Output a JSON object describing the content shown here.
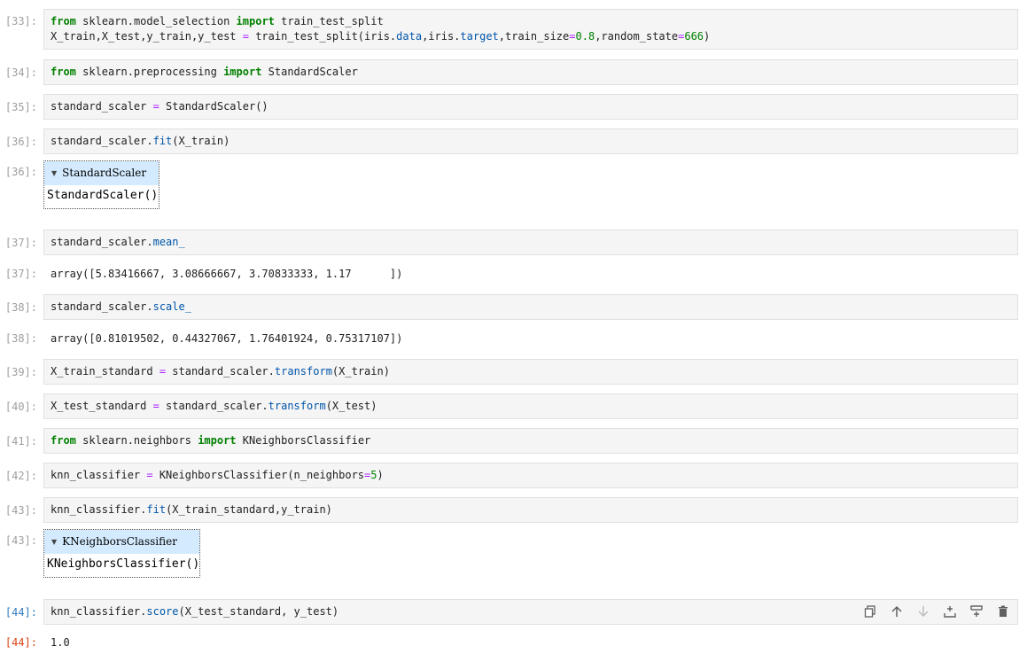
{
  "cells": [
    {
      "in_prompt": "[33]:",
      "line1_tokens": [
        "from",
        "sklearn.model_selection",
        "import",
        "train_test_split"
      ],
      "line2": "X_train,X_test,y_train,y_test = train_test_split(iris.data,iris.target,train_size=0.8,random_state=666)"
    },
    {
      "in_prompt": "[34]:",
      "text": "from sklearn.preprocessing import StandardScaler"
    },
    {
      "in_prompt": "[35]:",
      "text": "standard_scaler = StandardScaler()"
    },
    {
      "in_prompt": "[36]:",
      "text": "standard_scaler.fit(X_train)"
    },
    {
      "out_prompt": "[36]:",
      "widget_title": "StandardScaler",
      "widget_body": "StandardScaler()"
    },
    {
      "in_prompt": "[37]:",
      "text": "standard_scaler.mean_"
    },
    {
      "out_prompt": "[37]:",
      "output": "array([5.83416667, 3.08666667, 3.70833333, 1.17      ])"
    },
    {
      "in_prompt": "[38]:",
      "text": "standard_scaler.scale_"
    },
    {
      "out_prompt": "[38]:",
      "output": "array([0.81019502, 0.44327067, 1.76401924, 0.75317107])"
    },
    {
      "in_prompt": "[39]:",
      "text": "X_train_standard = standard_scaler.transform(X_train)"
    },
    {
      "in_prompt": "[40]:",
      "text": "X_test_standard = standard_scaler.transform(X_test)"
    },
    {
      "in_prompt": "[41]:",
      "text": "from sklearn.neighbors import KNeighborsClassifier"
    },
    {
      "in_prompt": "[42]:",
      "text": "knn_classifier = KNeighborsClassifier(n_neighbors=5)"
    },
    {
      "in_prompt": "[43]:",
      "text": "knn_classifier.fit(X_train_standard,y_train)"
    },
    {
      "out_prompt": "[43]:",
      "widget_title": "KNeighborsClassifier",
      "widget_body": "KNeighborsClassifier()"
    },
    {
      "in_prompt": "[44]:",
      "text": "knn_classifier.score(X_test_standard, y_test)"
    },
    {
      "out_prompt": "[44]:",
      "output": "1.0"
    }
  ],
  "toolbar": {
    "icons": [
      "duplicate-icon",
      "move-up-icon",
      "move-down-icon",
      "insert-above-icon",
      "insert-below-icon",
      "delete-icon"
    ]
  },
  "colors": {
    "active_in_prompt": "#2f7ec1",
    "active_out_prompt": "#d84315",
    "keyword": "#008000",
    "operator": "#aa22ff",
    "attribute": "#0055aa",
    "widget_header": "#d4ebff"
  }
}
